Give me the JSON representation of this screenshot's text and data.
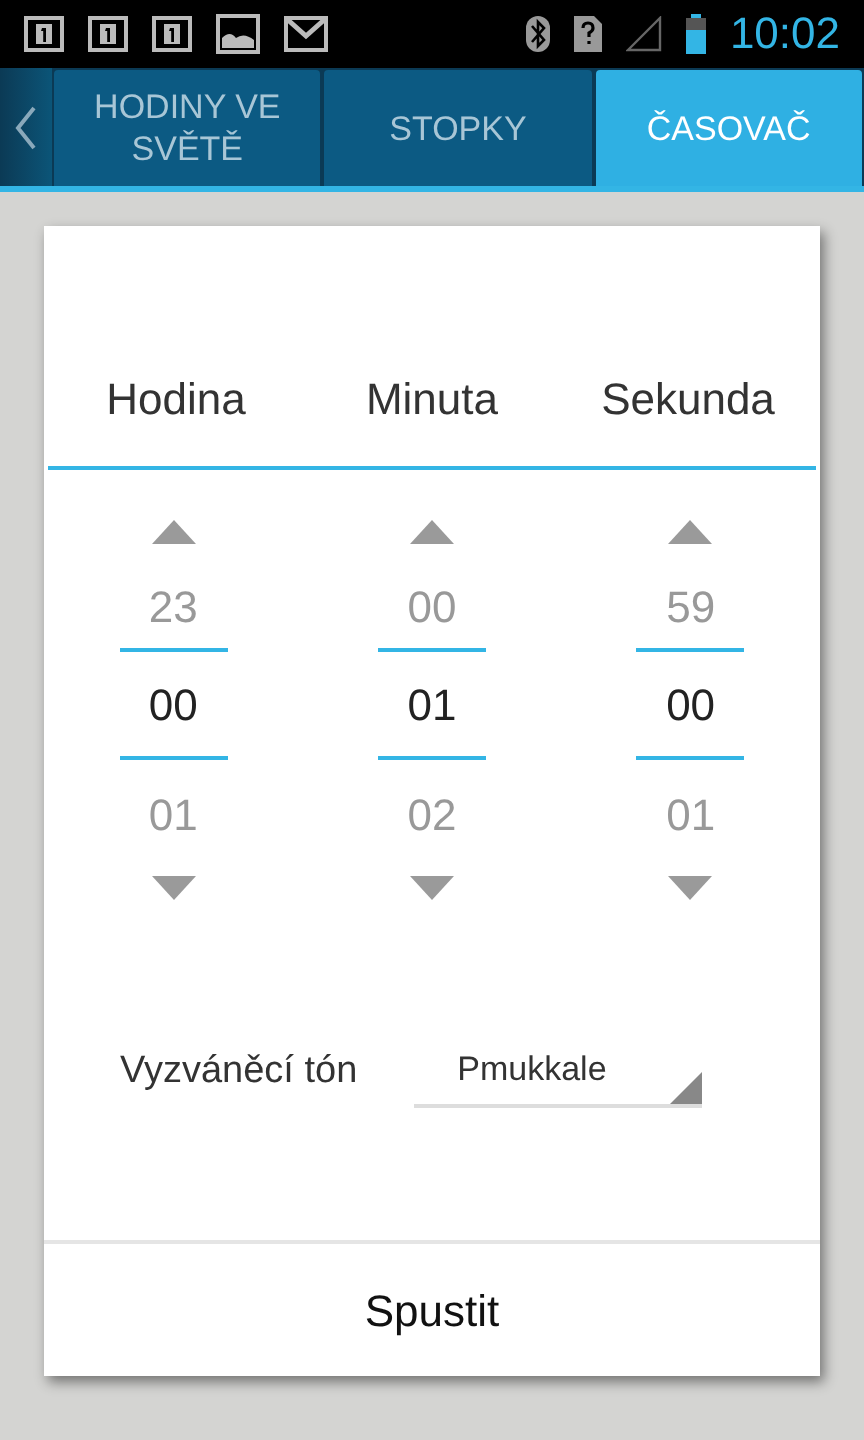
{
  "status_bar": {
    "time": "10:02"
  },
  "tabs": [
    {
      "label": "HODINY VE SVĚTĚ",
      "selected": false
    },
    {
      "label": "STOPKY",
      "selected": false
    },
    {
      "label": "ČASOVAČ",
      "selected": true
    }
  ],
  "timer": {
    "columns": [
      {
        "label": "Hodina",
        "previous": "23",
        "current": "00",
        "next": "01"
      },
      {
        "label": "Minuta",
        "previous": "00",
        "current": "01",
        "next": "02"
      },
      {
        "label": "Sekunda",
        "previous": "59",
        "current": "00",
        "next": "01"
      }
    ],
    "ringtone": {
      "label": "Vyzváněcí tón",
      "value": "Pmukkale"
    },
    "start_button": "Spustit"
  }
}
